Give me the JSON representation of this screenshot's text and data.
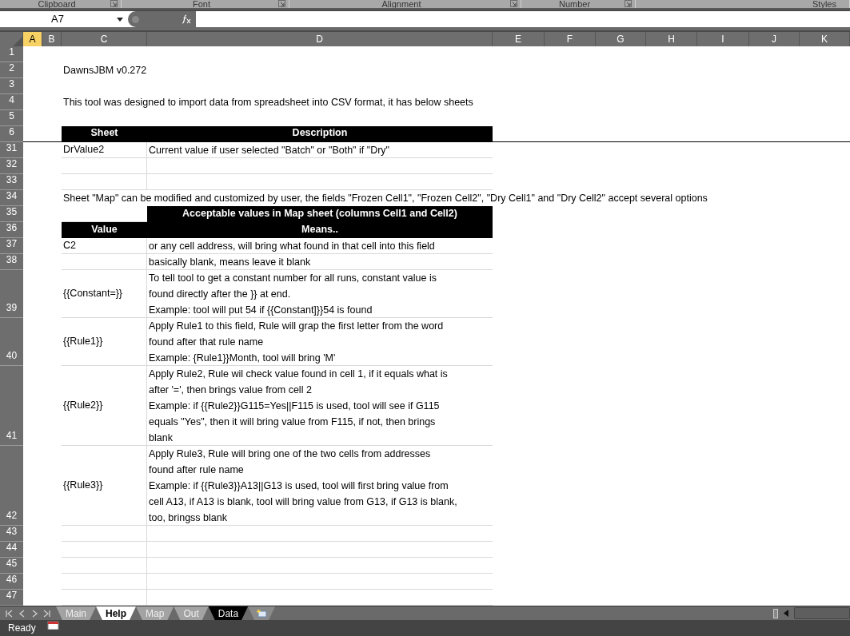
{
  "ribbon_groups": [
    {
      "label": "Clipboard",
      "launcher": true
    },
    {
      "label": "Font",
      "launcher": true
    },
    {
      "label": "Alignment",
      "launcher": true
    },
    {
      "label": "Number",
      "launcher": true
    },
    {
      "label": "Styles",
      "launcher": false
    }
  ],
  "name_box": {
    "value": "A7"
  },
  "columns": [
    {
      "label": "A",
      "selected": true
    },
    {
      "label": "B",
      "selected": false
    },
    {
      "label": "C",
      "selected": false
    },
    {
      "label": "D",
      "selected": false
    },
    {
      "label": "E",
      "selected": false
    },
    {
      "label": "F",
      "selected": false
    },
    {
      "label": "G",
      "selected": false
    },
    {
      "label": "H",
      "selected": false
    },
    {
      "label": "I",
      "selected": false
    },
    {
      "label": "J",
      "selected": false
    },
    {
      "label": "K",
      "selected": false
    }
  ],
  "rows": [
    {
      "num": "1",
      "kind": "blank"
    },
    {
      "num": "2",
      "kind": "note",
      "text": "DawnsJBM v0.272"
    },
    {
      "num": "3",
      "kind": "blank"
    },
    {
      "num": "4",
      "kind": "note",
      "text": "This tool was designed to import data from spreadsheet into CSV format, it has below sheets"
    },
    {
      "num": "5",
      "kind": "blank"
    },
    {
      "num": "6",
      "kind": "header",
      "value": "Sheet",
      "description": "Description",
      "freeze_pane": true
    },
    {
      "num": "31",
      "kind": "pair",
      "value": "DrValue2",
      "description": [
        "Current value if user selected \"Batch\" or \"Both\" if \"Dry\""
      ]
    },
    {
      "num": "32",
      "kind": "pair"
    },
    {
      "num": "33",
      "kind": "pair"
    },
    {
      "num": "34",
      "kind": "note",
      "text": "Sheet \"Map\" can be modified and customized by user, the fields \"Frozen Cell1\", \"Frozen Cell2\", \"Dry Cell1\" and \"Dry Cell2\" accept several options"
    },
    {
      "num": "35",
      "kind": "subheader",
      "description": "Acceptable values in Map sheet (columns Cell1 and Cell2)"
    },
    {
      "num": "36",
      "kind": "header",
      "value": "Value",
      "description": "Means.."
    },
    {
      "num": "37",
      "kind": "pair",
      "value": "C2",
      "description": [
        "or any cell address, will bring what found in that cell into this field"
      ]
    },
    {
      "num": "38",
      "kind": "pair",
      "description": [
        "basically blank, means leave it blank"
      ]
    },
    {
      "num": "39",
      "kind": "pair",
      "value": "{{Constant=}}",
      "description": [
        "To tell tool to get a constant number for all runs, constant value is",
        "found directly after the }} at end.",
        "Example: tool will put 54 if {{Constant]}}54 is found"
      ]
    },
    {
      "num": "40",
      "kind": "pair",
      "value": "{{Rule1}}",
      "description": [
        "Apply Rule1 to this field, Rule will grap the first letter from the word",
        "found after that rule name",
        "Example: {Rule1}}Month, tool will bring 'M'"
      ]
    },
    {
      "num": "41",
      "kind": "pair",
      "value": "{{Rule2}}",
      "description": [
        "Apply Rule2, Rule wil check value found in cell 1, if it equals what is",
        "after '=', then brings value from cell 2",
        "Example: if {{Rule2}}G115=Yes||F115 is used, tool will see if G115",
        "equals \"Yes\", then it will bring value from F115, if not, then brings",
        "blank"
      ]
    },
    {
      "num": "42",
      "kind": "pair",
      "value": "{{Rule3}}",
      "description": [
        "Apply Rule3, Rule will bring one of the two cells from addresses",
        "found after rule name",
        "Example: if {{Rule3}}A13||G13 is used, tool will first bring value from",
        "cell A13, if A13 is blank, tool will bring value from G13, if G13 is blank,",
        "too, bringss blank"
      ]
    },
    {
      "num": "43",
      "kind": "pair"
    },
    {
      "num": "44",
      "kind": "pair"
    },
    {
      "num": "45",
      "kind": "pair"
    },
    {
      "num": "46",
      "kind": "pair"
    },
    {
      "num": "47",
      "kind": "pair"
    }
  ],
  "sheet_tabs": [
    {
      "label": "Main",
      "selected": false,
      "color": "#a3a3a3"
    },
    {
      "label": "Help",
      "selected": true,
      "color": "#ffffff"
    },
    {
      "label": "Map",
      "selected": false,
      "color": "#a3a3a3"
    },
    {
      "label": "Out",
      "selected": false,
      "color": "#a3a3a3"
    },
    {
      "label": "Data",
      "selected": false,
      "color": "#000000"
    }
  ],
  "status_bar": {
    "text": "Ready"
  }
}
